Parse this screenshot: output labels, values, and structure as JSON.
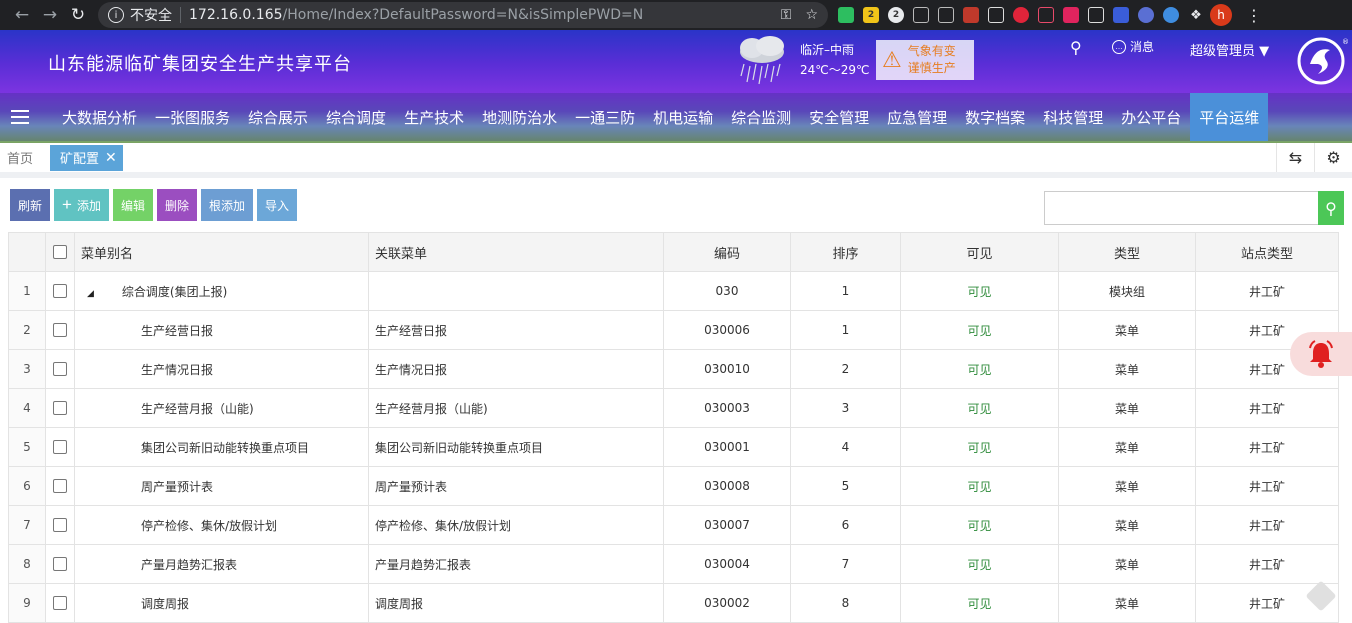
{
  "browser": {
    "insecure_label": "不安全",
    "url_host": "172.16.0.165",
    "url_path": "/Home/Index?DefaultPassword=N&isSimplePWD=N",
    "badges": [
      "2",
      "2"
    ],
    "profile_initial": "h"
  },
  "header": {
    "title": "山东能源临矿集团安全生产共享平台",
    "weather_city": "临沂–中雨",
    "weather_temp": "24℃～29℃",
    "warn_line1": "气象有变",
    "warn_line2": "谨慎生产",
    "messages_label": "消息",
    "user_label": "超级管理员"
  },
  "menu": [
    "大数据分析",
    "一张图服务",
    "综合展示",
    "综合调度",
    "生产技术",
    "地测防治水",
    "一通三防",
    "机电运输",
    "综合监测",
    "安全管理",
    "应急管理",
    "数字档案",
    "科技管理",
    "办公平台",
    "平台运维"
  ],
  "tabs": {
    "home": "首页",
    "active": "矿配置"
  },
  "toolbar": {
    "refresh": "刷新",
    "add": "添加",
    "edit": "编辑",
    "delete": "删除",
    "root_add": "根添加",
    "import": "导入"
  },
  "table": {
    "columns": [
      "菜单别名",
      "关联菜单",
      "编码",
      "排序",
      "可见",
      "类型",
      "站点类型"
    ],
    "rows": [
      {
        "n": "1",
        "name": "综合调度(集团上报)",
        "rel": "",
        "code": "030",
        "order": "1",
        "visible": "可见",
        "type": "模块组",
        "site": "井工矿"
      },
      {
        "n": "2",
        "name": "生产经营日报",
        "rel": "生产经营日报",
        "code": "030006",
        "order": "1",
        "visible": "可见",
        "type": "菜单",
        "site": "井工矿"
      },
      {
        "n": "3",
        "name": "生产情况日报",
        "rel": "生产情况日报",
        "code": "030010",
        "order": "2",
        "visible": "可见",
        "type": "菜单",
        "site": "井工矿"
      },
      {
        "n": "4",
        "name": "生产经营月报（山能)",
        "rel": "生产经营月报（山能)",
        "code": "030003",
        "order": "3",
        "visible": "可见",
        "type": "菜单",
        "site": "井工矿"
      },
      {
        "n": "5",
        "name": "集团公司新旧动能转换重点项目",
        "rel": "集团公司新旧动能转换重点项目",
        "code": "030001",
        "order": "4",
        "visible": "可见",
        "type": "菜单",
        "site": "井工矿"
      },
      {
        "n": "6",
        "name": "周产量预计表",
        "rel": "周产量预计表",
        "code": "030008",
        "order": "5",
        "visible": "可见",
        "type": "菜单",
        "site": "井工矿"
      },
      {
        "n": "7",
        "name": "停产检修、集休/放假计划",
        "rel": "停产检修、集休/放假计划",
        "code": "030007",
        "order": "6",
        "visible": "可见",
        "type": "菜单",
        "site": "井工矿"
      },
      {
        "n": "8",
        "name": "产量月趋势汇报表",
        "rel": "产量月趋势汇报表",
        "code": "030004",
        "order": "7",
        "visible": "可见",
        "type": "菜单",
        "site": "井工矿"
      },
      {
        "n": "9",
        "name": "调度周报",
        "rel": "调度周报",
        "code": "030002",
        "order": "8",
        "visible": "可见",
        "type": "菜单",
        "site": "井工矿"
      }
    ]
  }
}
